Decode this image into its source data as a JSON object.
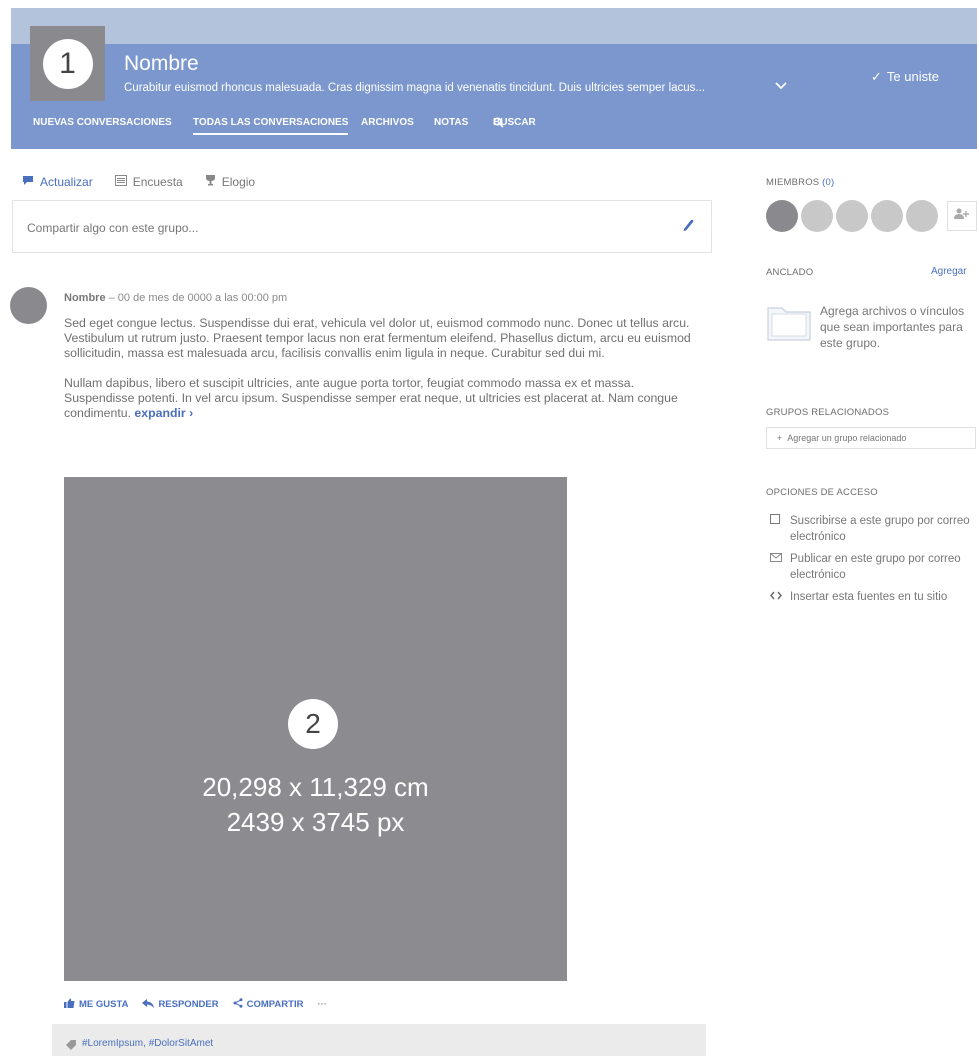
{
  "header": {
    "avatar_badge": "1",
    "group_name": "Nombre",
    "description": "Curabitur euismod rhoncus malesuada. Cras dignissim magna id venenatis tincidunt. Duis ultricies semper lacus...",
    "expand_icon": "chevron-down-icon",
    "joined_label": "Te uniste",
    "nav": [
      "NUEVAS CONVERSACIONES",
      "TODAS LAS CONVERSACIONES",
      "ARCHIVOS",
      "NOTAS",
      "BUSCAR"
    ],
    "active_nav_index": 1
  },
  "composer": {
    "tabs": [
      "Actualizar",
      "Encuesta",
      "Elogio"
    ],
    "active_tab_index": 0,
    "placeholder": "Compartir algo con este grupo..."
  },
  "post": {
    "author": "Nombre",
    "meta": " – 00 de mes de 0000 a las 00:00 pm",
    "paragraph1": "Sed eget congue lectus. Suspendisse dui erat, vehicula vel dolor ut, euismod commodo nunc. Donec ut tellus arcu. Vestibulum ut rutrum justo. Praesent tempor lacus non erat fermentum eleifend. Phasellus dictum, arcu eu euismod sollicitudin, massa est malesuada arcu, facilisis convallis enim ligula in neque. Curabitur sed dui mi.",
    "paragraph2": "Nullam dapibus, libero et suscipit ultricies, ante augue porta tortor, feugiat commodo massa ex et massa. Suspendisse potenti. In vel arcu ipsum. Suspendisse semper erat neque, ut ultricies est placerat at. Nam congue condimentu.",
    "expand_label": "expandir ›",
    "media": {
      "badge": "2",
      "dimension_cm": "20,298 x 11,329 cm",
      "dimension_px": "2439 x 3745 px"
    },
    "actions": {
      "like": "ME GUSTA",
      "reply": "RESPONDER",
      "share": "COMPARTIR",
      "more": "···"
    },
    "tags": "#LoremIpsum, #DolorSitAmet"
  },
  "sidebar": {
    "members_label": "MIEMBROS",
    "members_count": "(0)",
    "pinned_label": "ANCLADO",
    "pinned_add": "Agregar",
    "pinned_text": "Agrega archivos o vínculos que sean importantes para este grupo.",
    "related_label": "GRUPOS RELACIONADOS",
    "related_button": "Agregar un grupo relacionado",
    "access_label": "OPCIONES DE ACCESO",
    "access_options": [
      "Suscribirse a este grupo por correo electrónico",
      "Publicar en este grupo por correo electrónico",
      "Insertar esta fuentes en tu sitio"
    ]
  },
  "colors": {
    "header_bg": "#7b97cd",
    "top_strip": "#b4c3dc",
    "accent": "#4a6fbf",
    "placeholder_gray": "#8c8c90"
  }
}
